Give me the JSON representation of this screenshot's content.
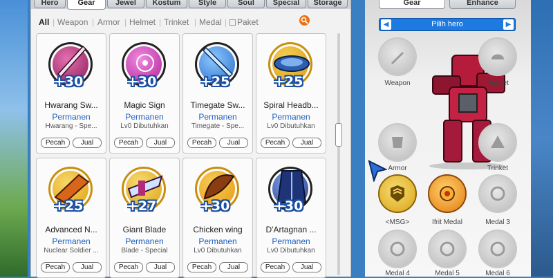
{
  "left_tabs": [
    "Hero",
    "Gear",
    "Jewel",
    "Kostum",
    "Style",
    "Soul",
    "Special",
    "Storage"
  ],
  "filters": [
    "All",
    "Weapon",
    "Armor",
    "Helmet",
    "Trinket",
    "Medal",
    "Paket"
  ],
  "cards": [
    {
      "bonus": "+30",
      "name": "Hwarang Sw...",
      "status": "Permanen",
      "sub": "Hwarang - Spe...",
      "btn1": "Pecah",
      "btn2": "Jual",
      "color": "#8c1f5a"
    },
    {
      "bonus": "+30",
      "name": "Magic Sign",
      "status": "Permanen",
      "sub": "Lv0 Dibutuhkan",
      "btn1": "Pecah",
      "btn2": "Jual",
      "color": "#b1249a"
    },
    {
      "bonus": "+25",
      "name": "Timegate Sw...",
      "status": "Permanen",
      "sub": "Timegate - Spe...",
      "btn1": "Pecah",
      "btn2": "Jual",
      "color": "#2a6fc9"
    },
    {
      "bonus": "+25",
      "name": "Spiral Headb...",
      "status": "Permanen",
      "sub": "Lv0 Dibutuhkan",
      "btn1": "Pecah",
      "btn2": "Jual",
      "color": "#2d5fb0"
    },
    {
      "bonus": "+25",
      "name": "Advanced N...",
      "status": "Permanen",
      "sub": "Nuclear Soldier ...",
      "btn1": "Pecah",
      "btn2": "Jual",
      "color": "#e2a012"
    },
    {
      "bonus": "+27",
      "name": "Giant Blade",
      "status": "Permanen",
      "sub": "Blade - Special",
      "btn1": "Pecah",
      "btn2": "Jual",
      "color": "#d9a316"
    },
    {
      "bonus": "+30",
      "name": "Chicken wing",
      "status": "Permanen",
      "sub": "Lv0 Dibutuhkan",
      "btn1": "Pecah",
      "btn2": "Jual",
      "color": "#e79a10"
    },
    {
      "bonus": "+30",
      "name": "D'Artagnan ...",
      "status": "Permanen",
      "sub": "Lv0 Dibutuhkan",
      "btn1": "Pecah",
      "btn2": "Jual",
      "color": "#2a3f8f"
    }
  ],
  "right_tabs": [
    "Gear",
    "Enhance"
  ],
  "hero_select": "Pilih hero",
  "slots": [
    {
      "label": "Weapon",
      "filled": false
    },
    {
      "label": "Helmet",
      "filled": false
    },
    {
      "label": "Armor",
      "filled": false
    },
    {
      "label": "Trinket",
      "filled": false
    },
    {
      "label": "<MSG>",
      "filled": true,
      "color": "#d8a316"
    },
    {
      "label": "Ifrit Medal",
      "filled": true,
      "color": "#e27a12"
    },
    {
      "label": "Medal 3",
      "filled": false
    },
    {
      "label": "Medal 4",
      "filled": false
    },
    {
      "label": "Medal 5",
      "filled": false
    },
    {
      "label": "Medal 6",
      "filled": false
    }
  ],
  "colors": {
    "accent": "#1d7ae0",
    "permanent_text": "#1f5fbf",
    "bonus_outline": "#1a4fa3"
  }
}
